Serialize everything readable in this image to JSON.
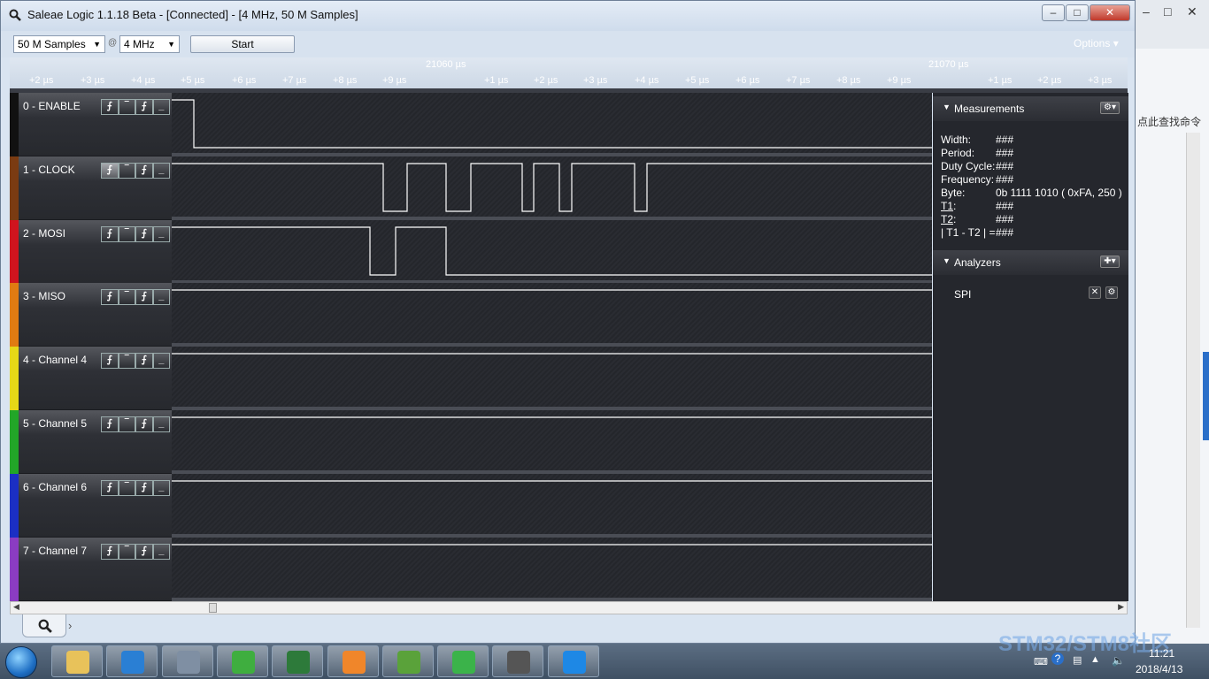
{
  "window": {
    "title": "Saleae Logic 1.1.18 Beta - [Connected] - [4 MHz, 50 M Samples]",
    "min_label": "‒",
    "max_label": "□",
    "close_label": "✕"
  },
  "toolbar": {
    "samples_value": "50 M Samples",
    "at_label": "@",
    "rate_value": "4 MHz",
    "start_label": "Start",
    "options_label": "Options ▾"
  },
  "ruler": {
    "ticks": [
      "+2 µs",
      "+3 µs",
      "+4 µs",
      "+5 µs",
      "+6 µs",
      "+7 µs",
      "+8 µs",
      "+9 µs",
      "+1 µs",
      "+2 µs",
      "+3 µs",
      "+4 µs",
      "+5 µs",
      "+6 µs",
      "+7 µs",
      "+8 µs",
      "+9 µs",
      "+1 µs",
      "+2 µs",
      "+3 µs"
    ],
    "major_left": "21060 µs",
    "major_right": "21070 µs"
  },
  "channels": [
    {
      "name": "0 - ENABLE",
      "color": "#111111"
    },
    {
      "name": "1 - CLOCK",
      "color": "#7a3b12"
    },
    {
      "name": "2 - MOSI",
      "color": "#d0141e"
    },
    {
      "name": "3 - MISO",
      "color": "#e07b12"
    },
    {
      "name": "4 - Channel 4",
      "color": "#e6d817"
    },
    {
      "name": "5 - Channel 5",
      "color": "#22a628"
    },
    {
      "name": "6 - Channel 6",
      "color": "#1b2fc4"
    },
    {
      "name": "7 - Channel 7",
      "color": "#8b3cc2"
    }
  ],
  "trigger_icons": [
    "⨍",
    "‾",
    "⨍",
    "_"
  ],
  "measurements": {
    "header": "Measurements",
    "rows": [
      {
        "label": "Width:",
        "value": "###"
      },
      {
        "label": "Period:",
        "value": "###"
      },
      {
        "label": "Duty Cycle:",
        "value": "###"
      },
      {
        "label": "Frequency:",
        "value": "###"
      },
      {
        "label": "Byte:",
        "value": "0b  1111  1010 ( 0xFA, 250 )"
      },
      {
        "label": "T1",
        "value": "###"
      },
      {
        "label": "T2",
        "value": "###"
      },
      {
        "label": "| T1 - T2 | =",
        "value": "###"
      }
    ]
  },
  "analyzers": {
    "header": "Analyzers",
    "items": [
      {
        "name": "SPI"
      }
    ]
  },
  "background_app": {
    "search_hint": "点此查找命令"
  },
  "taskbar": {
    "time": "11:21",
    "date": "2018/4/13",
    "watermark": "STM32/STM8社区",
    "app_colors": [
      "#e8c25a",
      "#2a7fd4",
      "#7f8fa3",
      "#3fae3f",
      "#2d7a3a",
      "#f0862a",
      "#5aa23a",
      "#3bb34a",
      "#555555",
      "#1e88e5"
    ]
  },
  "accent": {
    "wave": "#ffffff",
    "background": "#25272d"
  }
}
